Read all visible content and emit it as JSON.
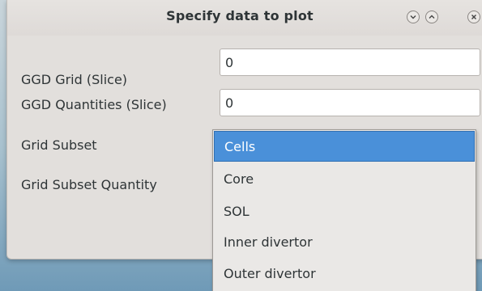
{
  "dialog": {
    "title": "Specify data to plot"
  },
  "form": {
    "ggd_grid_label": "GGD Grid (Slice)",
    "ggd_grid_value": "0",
    "ggd_quantities_label": "GGD Quantities (Slice)",
    "ggd_quantities_value": "0",
    "grid_subset_label": "Grid Subset",
    "grid_subset_quantity_label": "Grid Subset Quantity"
  },
  "dropdown": {
    "selected": "Cells",
    "options": [
      "Cells",
      "Core",
      "SOL",
      "Inner divertor",
      "Outer divertor"
    ]
  },
  "colors": {
    "selection": "#4a90d9",
    "dialog_bg": "#e2dfdc"
  }
}
